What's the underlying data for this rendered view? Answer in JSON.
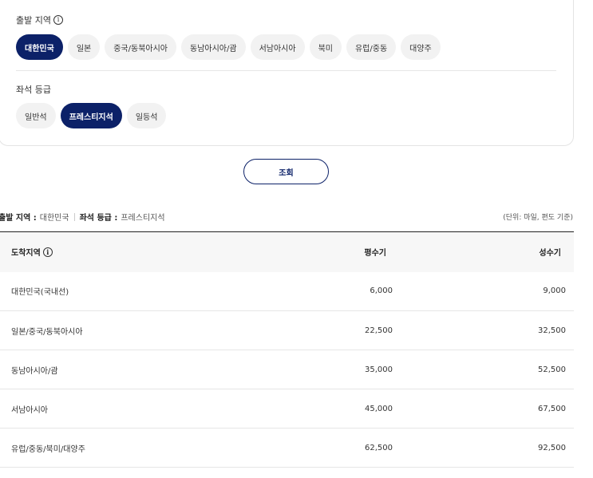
{
  "departure": {
    "label": "출발 지역",
    "regions": [
      {
        "label": "대한민국",
        "active": true
      },
      {
        "label": "일본",
        "active": false
      },
      {
        "label": "중국/동북아시아",
        "active": false
      },
      {
        "label": "동남아시아/괌",
        "active": false
      },
      {
        "label": "서남아시아",
        "active": false
      },
      {
        "label": "북미",
        "active": false
      },
      {
        "label": "유럽/중동",
        "active": false
      },
      {
        "label": "대양주",
        "active": false
      }
    ]
  },
  "seat_class": {
    "label": "좌석 등급",
    "options": [
      {
        "label": "일반석",
        "active": false
      },
      {
        "label": "프레스티지석",
        "active": true
      },
      {
        "label": "일등석",
        "active": false
      }
    ]
  },
  "search_button": "조회",
  "summary": {
    "departure_key": "출발 지역 :",
    "departure_value": "대한민국",
    "seat_key": "좌석 등급 :",
    "seat_value": "프레스티지석"
  },
  "unit_note": "(단위: 마일, 편도 기준)",
  "table": {
    "headers": {
      "destination": "도착지역",
      "off_peak": "평수기",
      "peak": "성수기"
    },
    "rows": [
      {
        "destination": "대한민국(국내선)",
        "off_peak": "6,000",
        "peak": "9,000"
      },
      {
        "destination": "일본/중국/동북아시아",
        "off_peak": "22,500",
        "peak": "32,500"
      },
      {
        "destination": "동남아시아/괌",
        "off_peak": "35,000",
        "peak": "52,500"
      },
      {
        "destination": "서남아시아",
        "off_peak": "45,000",
        "peak": "67,500"
      },
      {
        "destination": "유럽/중동/북미/대양주",
        "off_peak": "62,500",
        "peak": "92,500"
      }
    ]
  },
  "colors": {
    "accent": "#0c2168",
    "chip_bg": "#f2f2f2"
  }
}
